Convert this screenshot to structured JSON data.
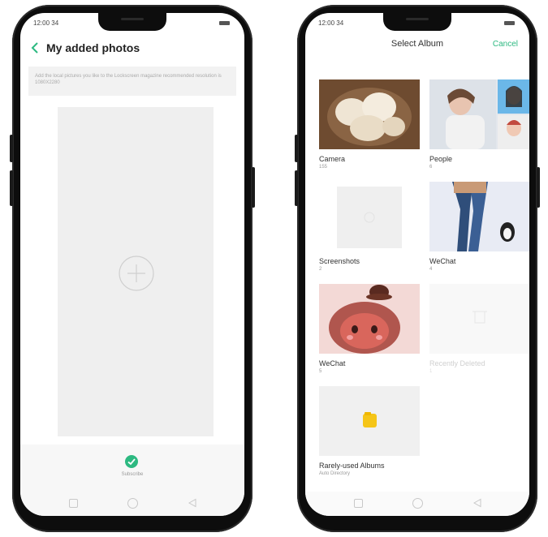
{
  "left_phone": {
    "status_time": "12:00 34",
    "header_title": "My added photos",
    "info_text": "Add the local pictures you like to the Lockscreen magazine recommended resolution is 1080X2280",
    "subscribe_label": "Subscribe"
  },
  "right_phone": {
    "status_time": "12:00 34",
    "header_title": "Select Album",
    "cancel_label": "Cancel",
    "albums": [
      {
        "name": "Camera",
        "count": "155"
      },
      {
        "name": "People",
        "count": "6"
      },
      {
        "name": "Screenshots",
        "count": "2"
      },
      {
        "name": "WeChat",
        "count": "4"
      },
      {
        "name": "WeChat",
        "count": "5"
      },
      {
        "name": "Recently Deleted",
        "count": "1"
      },
      {
        "name": "Rarely-used Albums",
        "count": "Auto Directory"
      }
    ]
  },
  "colors": {
    "accent": "#2db981",
    "folder": "#f5c518"
  }
}
